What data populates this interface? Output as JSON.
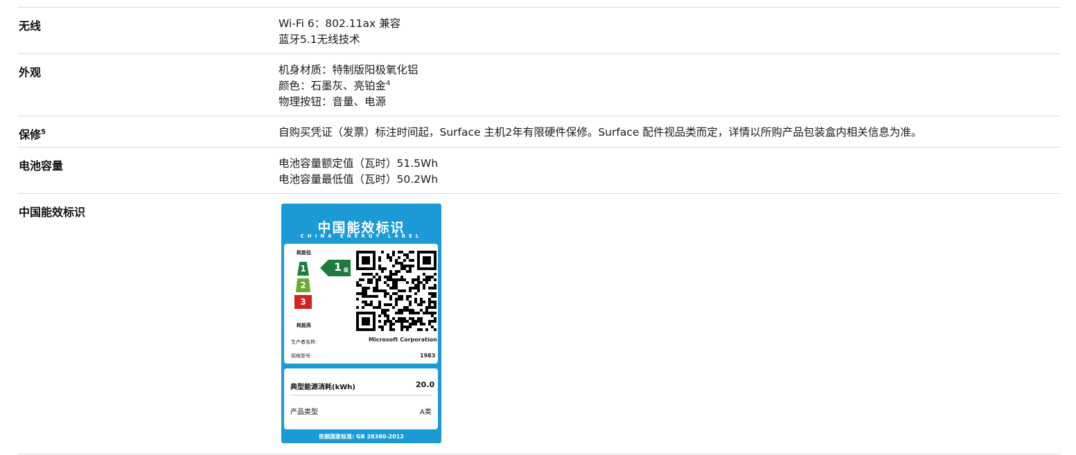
{
  "specs": {
    "wireless": {
      "label": "无线",
      "lines": [
        "Wi-Fi 6：802.11ax 兼容",
        "蓝牙5.1无线技术"
      ]
    },
    "appearance": {
      "label": "外观",
      "line1": "机身材质：特制版阳极氧化铝",
      "line2": "颜色：石墨灰、亮铂金",
      "line2_sup": "4",
      "line3": "物理按钮：音量、电源"
    },
    "warranty": {
      "label": "保修",
      "label_sup": "5",
      "text": "自购买凭证（发票）标注时间起，Surface 主机2年有限硬件保修。Surface 配件视品类而定，详情以所购产品包装盒内相关信息为准。"
    },
    "battery": {
      "label": "电池容量",
      "lines": [
        "电池容量额定值（瓦时）51.5Wh",
        "电池容量最低值（瓦时）50.2Wh"
      ]
    },
    "energy": {
      "label": "中国能效标识"
    }
  },
  "energy_label": {
    "title": "中国能效标识",
    "subtitle": "CHINA ENERGY LABEL",
    "low": "耗能低",
    "high": "耗能高",
    "grades": [
      "1",
      "2",
      "3"
    ],
    "grade_colors": [
      "#1f7a3d",
      "#6aab2e",
      "#d42222"
    ],
    "rating": "1",
    "rating_unit": "级",
    "manufacturer_label": "生产者名称:",
    "manufacturer": "Microsoft Corporation",
    "model_label": "规格型号:",
    "model": "1983",
    "consumption_label": "典型能源消耗(kWh)",
    "consumption": "20.0",
    "type_label": "产品类型",
    "type": "A类",
    "standard": "依据国家标准: GB 28380-2012"
  }
}
